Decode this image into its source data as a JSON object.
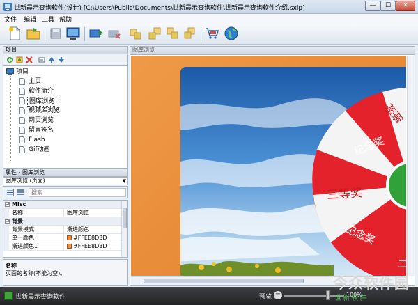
{
  "window": {
    "title": "世新晨示查询软件(设计) [C:\\Users\\Public\\Documents\\世新晨示查询软件\\世新晨示查询软件介绍.sxip]",
    "min": "—",
    "max": "☐",
    "close": "✕"
  },
  "menu": [
    "文件",
    "编辑",
    "工具",
    "帮助"
  ],
  "toolbar": {
    "icons": [
      "new-page-icon",
      "open-folder-icon",
      "save-icon",
      "publish-icon",
      "add-item-icon",
      "remove-item-icon",
      "align-left-icon",
      "align-right-icon",
      "align-top-icon",
      "align-bottom-icon",
      "cart-icon",
      "globe-icon"
    ]
  },
  "tree": {
    "header": "项目",
    "root": "项目",
    "items": [
      "主页",
      "软件简介",
      "图库浏览",
      "视频库浏览",
      "网页浏览",
      "留言签名",
      "Flash",
      "Gif动画"
    ],
    "selected_index": 2
  },
  "properties": {
    "header": "属性 - 图库浏览",
    "object": "图库浏览 (页面)",
    "search_placeholder": "搜索",
    "rows": [
      {
        "type": "cat",
        "label": "Misc",
        "toggle": "⊟"
      },
      {
        "type": "prop",
        "key": "名称",
        "value": "图库浏览"
      },
      {
        "type": "cat",
        "label": "背景",
        "toggle": "⊟"
      },
      {
        "type": "prop",
        "key": "背景模式",
        "value": "渐进颜色"
      },
      {
        "type": "prop",
        "key": "单一颜色",
        "value": "#FFEE8D3D",
        "swatch": "#f58a36"
      },
      {
        "type": "prop",
        "key": "渐进颜色1",
        "value": "#FFEE8D3D",
        "swatch": "#f58a36"
      }
    ],
    "description_title": "名称",
    "description_text": "页面的名称(不能为空)。"
  },
  "preview": {
    "header": "图库浏览",
    "wheel_texts": [
      "谢谢",
      "纪念奖",
      "三等奖",
      "纪念奖",
      "二"
    ]
  },
  "statusbar": {
    "text": "世新晨示查询软件",
    "preview_label": "预览",
    "zoom": "100%",
    "zoom_level": 0.7
  },
  "watermark": {
    "text": "今众软件园",
    "sub": "世新软件"
  }
}
